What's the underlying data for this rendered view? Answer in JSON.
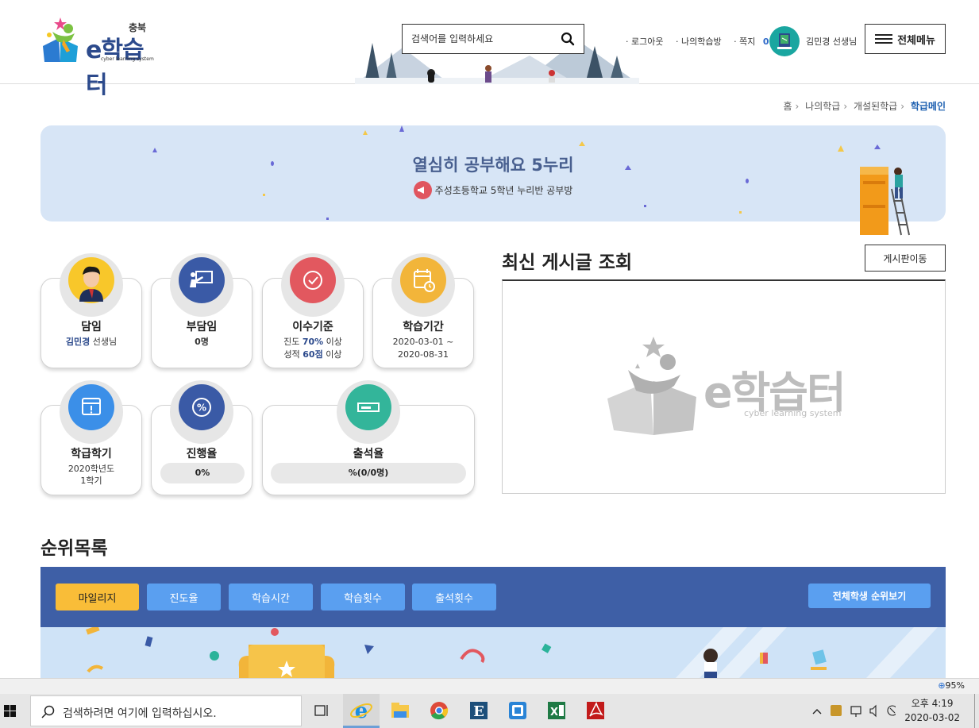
{
  "header": {
    "logo": {
      "region": "충북",
      "brand": "e학습터",
      "tagline": "cyber learning system"
    },
    "search": {
      "placeholder": "검색어를 입력하세요"
    },
    "links": {
      "logout": "로그아웃",
      "my_room": "나의학습방",
      "message_label": "쪽지",
      "message_count": "0"
    },
    "user": {
      "name": "김민경 선생님"
    },
    "all_menu_label": "전체메뉴"
  },
  "breadcrumb": {
    "items": [
      "홈",
      "나의학급",
      "개설된학급"
    ],
    "current": "학급메인"
  },
  "banner": {
    "title": "열심히 공부해요 5누리",
    "subtitle": "주성초등학교 5학년 누리반 공부방"
  },
  "cards": {
    "homeroom": {
      "title": "담임",
      "name": "김민경",
      "suffix": " 선생님"
    },
    "sub_teacher": {
      "title": "부담임",
      "value": "0명"
    },
    "criteria": {
      "title": "이수기준",
      "progress_prefix": "진도 ",
      "progress_value": "70%",
      "progress_suffix": " 이상",
      "score_prefix": "성적 ",
      "score_value": "60점",
      "score_suffix": " 이상"
    },
    "period": {
      "title": "학습기간",
      "start": "2020-03-01 ~",
      "end": "2020-08-31"
    },
    "semester": {
      "title": "학급학기",
      "year": "2020학년도",
      "term": "1학기"
    },
    "progress_rate": {
      "title": "진행율",
      "value": "0%"
    },
    "attendance": {
      "title": "출석율",
      "value": "%(0/0명)"
    }
  },
  "board": {
    "title": "최신 게시글 조회",
    "move_button": "게시판이동",
    "watermark_brand": "e학습터",
    "watermark_sub": "cyber learning system"
  },
  "ranking": {
    "title": "순위목록",
    "tabs": [
      "마일리지",
      "진도율",
      "학습시간",
      "학습횟수",
      "출석횟수"
    ],
    "active_tab": "마일리지",
    "all_button": "전체학생 순위보기"
  },
  "browser": {
    "zoom": "95%"
  },
  "taskbar": {
    "search_placeholder": "검색하려면 여기에 입력하십시오.",
    "time": "오후 4:19",
    "date": "2020-03-02"
  },
  "colors": {
    "accent": "#2c4a8c",
    "rank_panel": "#3e5fa6",
    "tab": "#5a9ff0",
    "tab_active": "#f9bd38",
    "banner_bg": "#d7e5f6"
  }
}
